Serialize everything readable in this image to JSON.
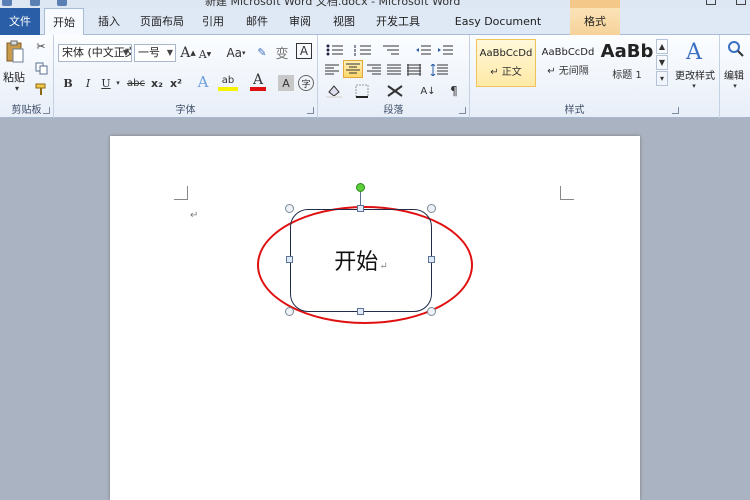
{
  "window": {
    "title": "新建 Microsoft Word 文档.docx - Microsoft Word"
  },
  "tabs": {
    "file": "文件",
    "home": "开始",
    "insert": "插入",
    "layout": "页面布局",
    "references": "引用",
    "mailings": "邮件",
    "review": "审阅",
    "view": "视图",
    "developer": "开发工具",
    "easy_doc": "Easy Document Creator",
    "format": "格式"
  },
  "clipboard": {
    "paste_label": "粘贴",
    "group_label": "剪贴板"
  },
  "font": {
    "font_name": "宋体 (中文正文",
    "font_size": "一号",
    "grow": "A",
    "shrink": "A",
    "change_case": "Aa",
    "bold": "B",
    "italic": "I",
    "underline": "U",
    "strike": "abc",
    "subscript": "x₂",
    "superscript": "x²",
    "text_effect": "A",
    "highlight": "ab",
    "font_color": "A",
    "char_shading": "A",
    "enclose": "字",
    "phonetic": "文",
    "wen": "变",
    "border_char": "A",
    "group_label": "字体"
  },
  "paragraph": {
    "group_label": "段落"
  },
  "styles": {
    "items": [
      {
        "preview": "AaBbCcDd",
        "name": "↵ 正文"
      },
      {
        "preview": "AaBbCcDd",
        "name": "↵ 无间隔"
      },
      {
        "preview": "AaBb",
        "name": "标题 1"
      }
    ],
    "change_styles": "更改样式",
    "group_label": "样式"
  },
  "editing": {
    "label": "编辑"
  },
  "document": {
    "shape_text": "开始",
    "para_mark": "↵"
  },
  "colors": {
    "highlight_ellipse": "#e01010",
    "file_tab": "#2a5ea6",
    "rotate_handle": "#5ccf3a"
  }
}
